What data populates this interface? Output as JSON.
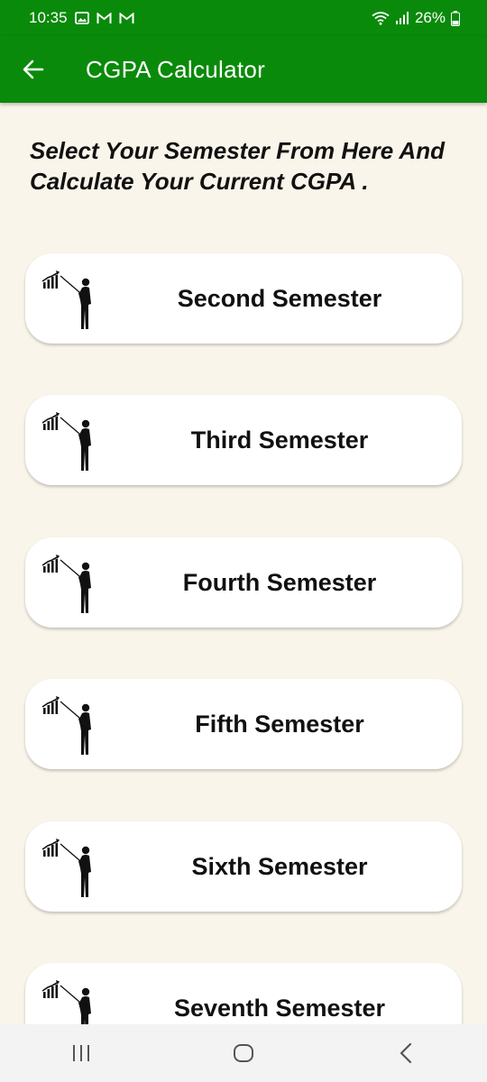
{
  "status_bar": {
    "time": "10:35",
    "battery": "26%",
    "icons": [
      "gallery-icon",
      "gmail-icon",
      "gmail-icon",
      "wifi-icon",
      "signal-icon",
      "battery-icon"
    ]
  },
  "app_bar": {
    "title": "CGPA Calculator",
    "back_icon": "arrow-left-icon"
  },
  "heading": {
    "line1": "Select Your Semester From Here And",
    "line2": "Calculate Your Current CGPA ."
  },
  "semesters": [
    {
      "label": "Second Semester"
    },
    {
      "label": "Third Semester"
    },
    {
      "label": "Fourth Semester"
    },
    {
      "label": "Fifth Semester"
    },
    {
      "label": "Sixth Semester"
    },
    {
      "label": "Seventh Semester"
    }
  ],
  "nav_bar": {
    "icons": [
      "recent-apps-icon",
      "home-icon",
      "back-icon"
    ]
  },
  "colors": {
    "primary": "#0A8A0A",
    "background": "#FAF5EA",
    "card": "#FFFFFF"
  }
}
